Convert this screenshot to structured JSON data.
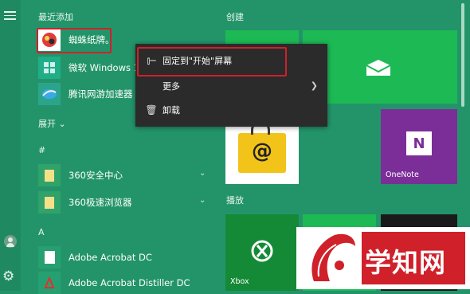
{
  "sections": {
    "recent": "最近添加",
    "expand": "展开",
    "hash": "#",
    "a": "A",
    "create": "创建",
    "play": "播放"
  },
  "apps": [
    {
      "label": "蜘蛛纸牌。"
    },
    {
      "label": "微软 Windows 1"
    },
    {
      "label": "腾讯网游加速器"
    },
    {
      "label": "360安全中心"
    },
    {
      "label": "360极速浏览器"
    },
    {
      "label": "Adobe Acrobat DC"
    },
    {
      "label": "Adobe Acrobat Distiller DC"
    }
  ],
  "context_menu": {
    "pin": "固定到\"开始\"屏幕",
    "more": "更多",
    "uninstall": "卸载"
  },
  "tiles": {
    "onenote": "OneNote",
    "xbox": "Xbox"
  },
  "watermark": "学知网",
  "colors": {
    "background": "#23946a",
    "tile": "#1db954",
    "highlight_box": "#d0202a",
    "menu": "#2b2b2b",
    "onenote": "#7b2e98"
  }
}
